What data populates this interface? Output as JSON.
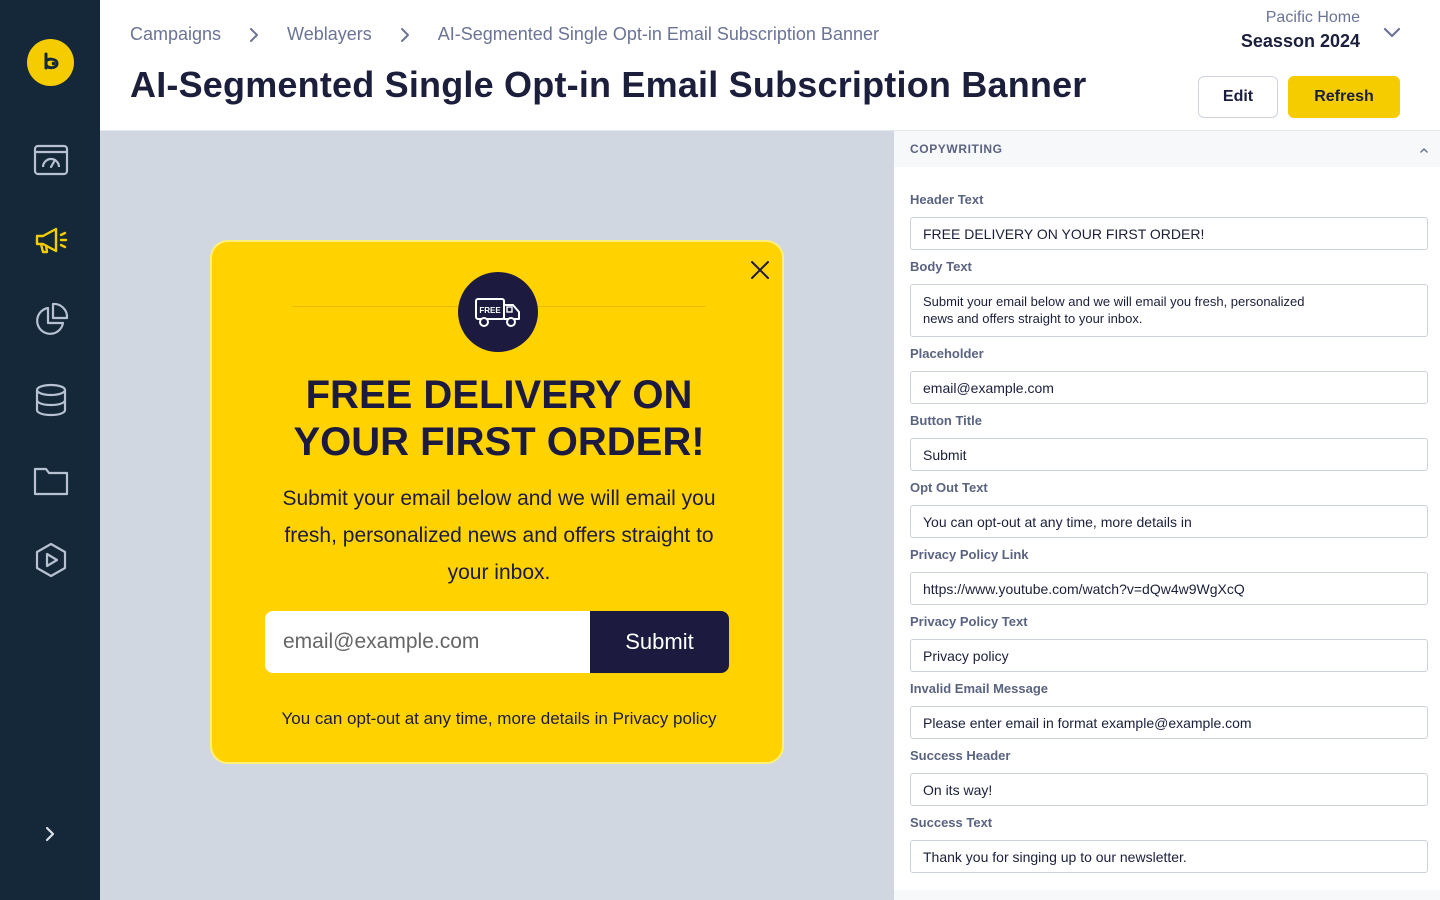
{
  "sidebar": {
    "logo_letter": "b",
    "items": [
      {
        "icon": "dashboard-icon"
      },
      {
        "icon": "megaphone-icon",
        "active": true
      },
      {
        "icon": "pie-chart-icon"
      },
      {
        "icon": "database-icon"
      },
      {
        "icon": "folder-icon"
      },
      {
        "icon": "play-icon"
      }
    ],
    "accent": "#f5cc00",
    "background": "#14283a"
  },
  "header": {
    "breadcrumb": [
      "Campaigns",
      "Weblayers",
      "AI-Segmented Single Opt-in Email Subscription Banner"
    ],
    "title": "AI-Segmented Single Opt-in Email Subscription Banner",
    "project_name": "Pacific Home",
    "project_season": "Seasson 2024",
    "edit_label": "Edit",
    "refresh_label": "Refresh"
  },
  "banner": {
    "badge_text": "FREE",
    "header_line1": "FREE DELIVERY ON",
    "header_line2": "YOUR FIRST ORDER!",
    "body_line1": "Submit your email below and we will email you",
    "body_line2": "fresh, personalized news and offers straight to",
    "body_line3": "your inbox.",
    "placeholder": "email@example.com",
    "button": "Submit",
    "optout": "You can opt-out at any time, more details in",
    "privacy_link": "Privacy policy",
    "background": "#ffd200",
    "dark": "#1c1b3f"
  },
  "panel": {
    "section_title": "COPYWRITING",
    "fields": {
      "header_text": {
        "label": "Header Text",
        "value": "FREE DELIVERY ON YOUR FIRST ORDER!"
      },
      "body_text": {
        "label": "Body Text",
        "value": "Submit your email below and we will email you fresh, personalized news and offers straight to your inbox."
      },
      "placeholder": {
        "label": "Placeholder",
        "value": "email@example.com"
      },
      "button_title": {
        "label": "Button Title",
        "value": "Submit"
      },
      "opt_out_text": {
        "label": "Opt Out Text",
        "value": "You can opt-out at any time, more details in"
      },
      "privacy_policy_link": {
        "label": "Privacy Policy Link",
        "value": "https://www.youtube.com/watch?v=dQw4w9WgXcQ"
      },
      "privacy_policy_text": {
        "label": "Privacy Policy Text",
        "value": "Privacy policy"
      },
      "invalid_email_message": {
        "label": "Invalid Email Message",
        "value": "Please enter email in format example@example.com"
      },
      "success_header": {
        "label": "Success Header",
        "value": "On its way!"
      },
      "success_text": {
        "label": "Success Text",
        "value": "Thank you for singing up to our newsletter."
      }
    }
  }
}
